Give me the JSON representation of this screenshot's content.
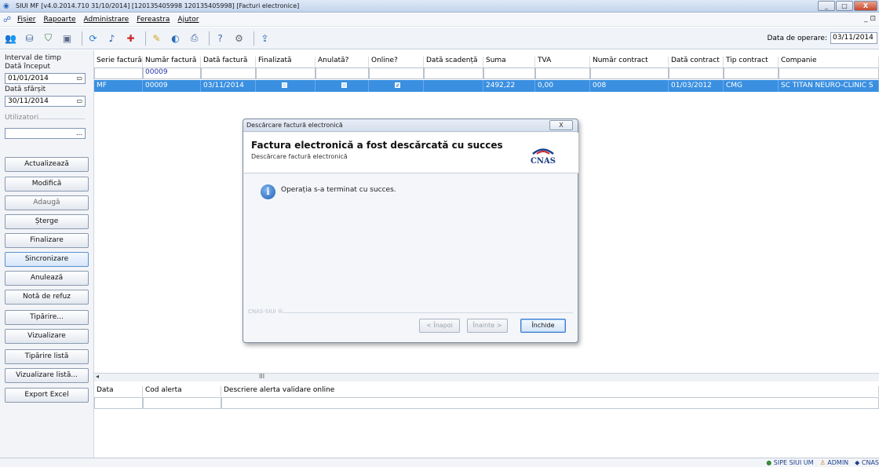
{
  "window": {
    "title": "SIUI MF [v4.0.2014.710  31/10/2014]  [120135405998 120135405998]  [Facturi electronice]",
    "buttons": [
      "_",
      "□",
      "X"
    ]
  },
  "menu": {
    "items": [
      "Fișier",
      "Rapoarte",
      "Administrare",
      "Fereastra",
      "Ajutor"
    ],
    "mdi_controls": "_ ⊡"
  },
  "toolbar": {
    "icons": [
      "users-icon",
      "database-icon",
      "filter-icon",
      "save-icon",
      "sync-icon",
      "bell-icon",
      "add-icon",
      "edit-icon",
      "cancel-icon",
      "print-icon",
      "help-icon",
      "settings-icon",
      "exit-icon"
    ],
    "date_label": "Data de operare:",
    "date_value": "03/11/2014"
  },
  "left": {
    "interval_label": "Interval de timp",
    "start_label": "Dată început",
    "start_value": "01/01/2014",
    "end_label": "Dată sfârșit",
    "end_value": "30/11/2014",
    "users_label": "Utilizatori",
    "users_value": "",
    "buttons": [
      "Actualizează",
      "Modifică",
      "Adaugă",
      "Șterge",
      "Finalizare",
      "Sincronizare",
      "Anulează",
      "Notă de refuz",
      "Tipărire...",
      "Vizualizare",
      "Tipărire listă",
      "Vizualizare listă...",
      "Export Excel"
    ]
  },
  "grid": {
    "headers": [
      "Serie factură",
      "Număr factură",
      "Dată factură",
      "Finalizată",
      "Anulată?",
      "Online?",
      "Dată scadență",
      "Suma",
      "TVA",
      "Număr contract",
      "Dată contract",
      "Tip contract",
      "Companie"
    ],
    "filter_values": [
      "",
      "00009",
      "",
      "",
      "",
      "",
      "",
      "",
      "",
      "",
      "",
      "",
      ""
    ],
    "row": {
      "serie": "MF",
      "numar": "00009",
      "data": "03/11/2014",
      "finalizata": false,
      "anulata": false,
      "online": true,
      "scadenta": "",
      "suma": "2492,22",
      "tva": "0,00",
      "numar_contract": "008",
      "data_contract": "01/03/2012",
      "tip_contract": "CMG",
      "companie": "SC TITAN NEURO-CLINIC S"
    },
    "hscroll_thumb": "III"
  },
  "alerts": {
    "headers": [
      "Data",
      "Cod alerta",
      "Descriere alerta validare online"
    ]
  },
  "status": {
    "items": [
      "SIPE SIUI UM",
      "ADMIN",
      "CNAS"
    ]
  },
  "dialog": {
    "title": "Descărcare factură electronică",
    "close": "X",
    "heading": "Factura electronică a fost descărcată cu succes",
    "subheading": "Descărcare factură electronică",
    "logo_text": "CNAS",
    "message": "Operația s-a terminat cu succes.",
    "footer_label": "CNAS-SIUI ®",
    "btn_back": "< Înapoi",
    "btn_next": "Înainte >",
    "btn_close": "Închide"
  },
  "colors": {
    "selection": "#3a8fe0",
    "dialog_primary": "#3d7bd0"
  }
}
